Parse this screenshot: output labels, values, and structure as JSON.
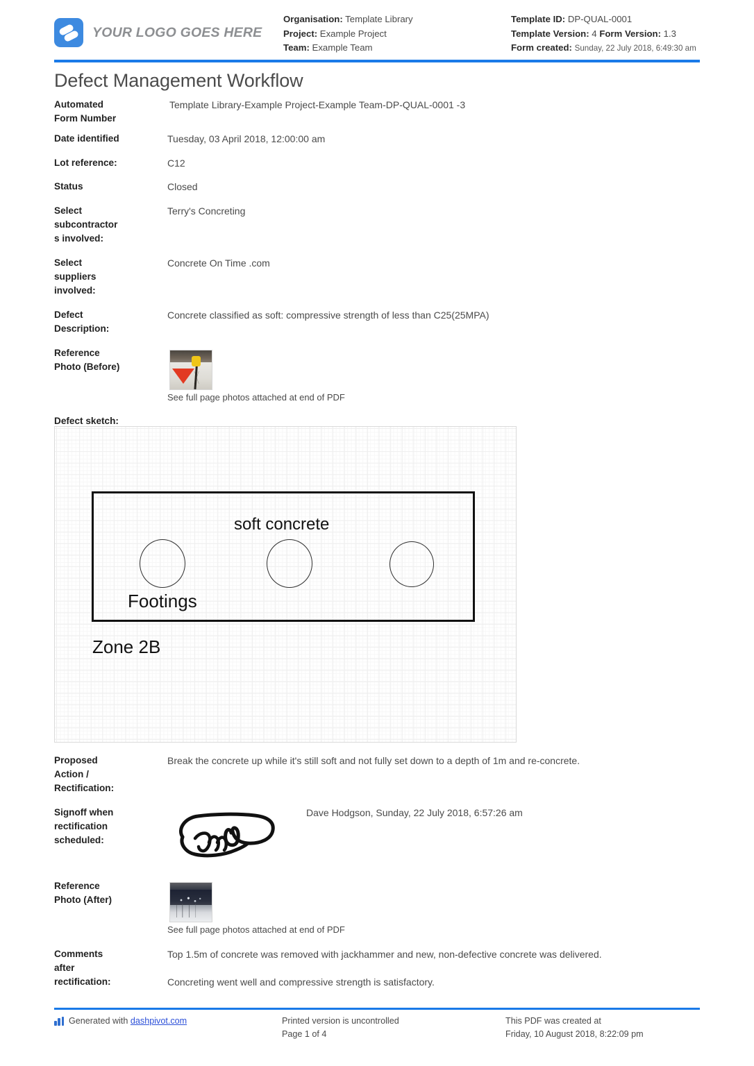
{
  "header": {
    "logo_text": "YOUR LOGO GOES HERE",
    "organisation_label": "Organisation:",
    "organisation_value": "Template Library",
    "project_label": "Project:",
    "project_value": "Example Project",
    "team_label": "Team:",
    "team_value": "Example Team",
    "template_id_label": "Template ID:",
    "template_id_value": "DP-QUAL-0001",
    "template_version_label": "Template Version:",
    "template_version_value": "4",
    "form_version_label": "Form Version:",
    "form_version_value": "1.3",
    "form_created_label": "Form created:",
    "form_created_value": "Sunday, 22 July 2018, 6:49:30 am"
  },
  "title": "Defect Management Workflow",
  "fields": {
    "automated_form_number": {
      "label_line1": "Automated",
      "label_line2": "Form Number",
      "value": "Template Library-Example Project-Example Team-DP-QUAL-0001   -3"
    },
    "date_identified": {
      "label": "Date identified",
      "value": "Tuesday, 03 April 2018, 12:00:00 am"
    },
    "lot_reference": {
      "label": "Lot reference:",
      "value": "C12"
    },
    "status": {
      "label": "Status",
      "value": "Closed"
    },
    "subcontractors": {
      "label_line1": "Select",
      "label_line2": "subcontractor",
      "label_line3": "s involved:",
      "value": "Terry's Concreting"
    },
    "suppliers": {
      "label_line1": "Select",
      "label_line2": "suppliers",
      "label_line3": "involved:",
      "value": "Concrete On Time .com"
    },
    "defect_description": {
      "label_line1": "Defect",
      "label_line2": "Description:",
      "value": "Concrete classified as soft: compressive strength of less than C25(25MPA)"
    },
    "reference_photo_before": {
      "label_line1": "Reference",
      "label_line2": "Photo (Before)",
      "note": "See full page photos attached at end of PDF"
    },
    "defect_sketch": {
      "label": "Defect sketch:"
    },
    "proposed_action": {
      "label_line1": "Proposed",
      "label_line2": "Action /",
      "label_line3": "Rectification:",
      "value": "Break the concrete up while it's still soft and not fully set down to a depth of 1m and re-concrete."
    },
    "signoff": {
      "label_line1": "Signoff when",
      "label_line2": "rectification",
      "label_line3": "scheduled:",
      "value": "Dave Hodgson, Sunday, 22 July 2018, 6:57:26 am"
    },
    "reference_photo_after": {
      "label_line1": "Reference",
      "label_line2": "Photo (After)",
      "note": "See full page photos attached at end of PDF"
    },
    "comments_after_rectification": {
      "label_line1": "Comments",
      "label_line2": "after",
      "label_line3": "rectification:",
      "value_line1": "Top 1.5m of concrete was removed with jackhammer and new, non-defective concrete was delivered.",
      "value_line2": "Concreting went well and compressive strength is satisfactory."
    }
  },
  "sketch": {
    "label_soft_concrete": "soft concrete",
    "label_footings": "Footings",
    "label_zone": "Zone 2B"
  },
  "footer": {
    "generated_prefix": "Generated with",
    "generated_link": "dashpivot.com",
    "printed_notice": "Printed version is uncontrolled",
    "page_number": "Page 1 of 4",
    "created_label": "This PDF was created at",
    "created_value": "Friday, 10 August 2018, 8:22:09 pm"
  },
  "colors": {
    "accent_blue": "#1a7ae8",
    "logo_blue": "#3d8ae0",
    "link_blue": "#2b4fd8"
  }
}
